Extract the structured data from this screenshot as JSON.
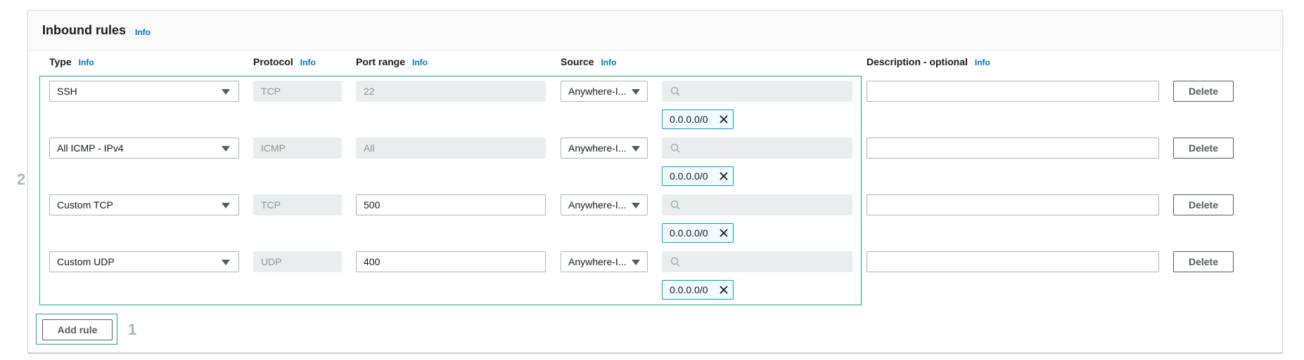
{
  "section": {
    "title": "Inbound rules",
    "info": "Info"
  },
  "columns": [
    {
      "label": "Type",
      "info": "Info"
    },
    {
      "label": "Protocol",
      "info": "Info"
    },
    {
      "label": "Port range",
      "info": "Info"
    },
    {
      "label": "Source",
      "info": "Info"
    },
    {
      "label": "Description - optional",
      "info": "Info"
    }
  ],
  "rules": [
    {
      "type": "SSH",
      "protocol": "TCP",
      "port": "22",
      "port_editable": false,
      "source": "Anywhere-I...",
      "search_value": "",
      "token": "0.0.0.0/0",
      "description": "",
      "delete_label": "Delete"
    },
    {
      "type": "All ICMP - IPv4",
      "protocol": "ICMP",
      "port": "All",
      "port_editable": false,
      "source": "Anywhere-I...",
      "search_value": "",
      "token": "0.0.0.0/0",
      "description": "",
      "delete_label": "Delete"
    },
    {
      "type": "Custom TCP",
      "protocol": "TCP",
      "port": "500",
      "port_editable": true,
      "source": "Anywhere-I...",
      "search_value": "",
      "token": "0.0.0.0/0",
      "description": "",
      "delete_label": "Delete"
    },
    {
      "type": "Custom UDP",
      "protocol": "UDP",
      "port": "400",
      "port_editable": true,
      "source": "Anywhere-I...",
      "search_value": "",
      "token": "0.0.0.0/0",
      "description": "",
      "delete_label": "Delete"
    }
  ],
  "add_rule_label": "Add rule",
  "annotations": {
    "rules_box": "2",
    "add_box": "1"
  },
  "colors": {
    "accent": "#0073bb",
    "highlight": "#1aa88c",
    "token_border": "#00a1c9"
  }
}
